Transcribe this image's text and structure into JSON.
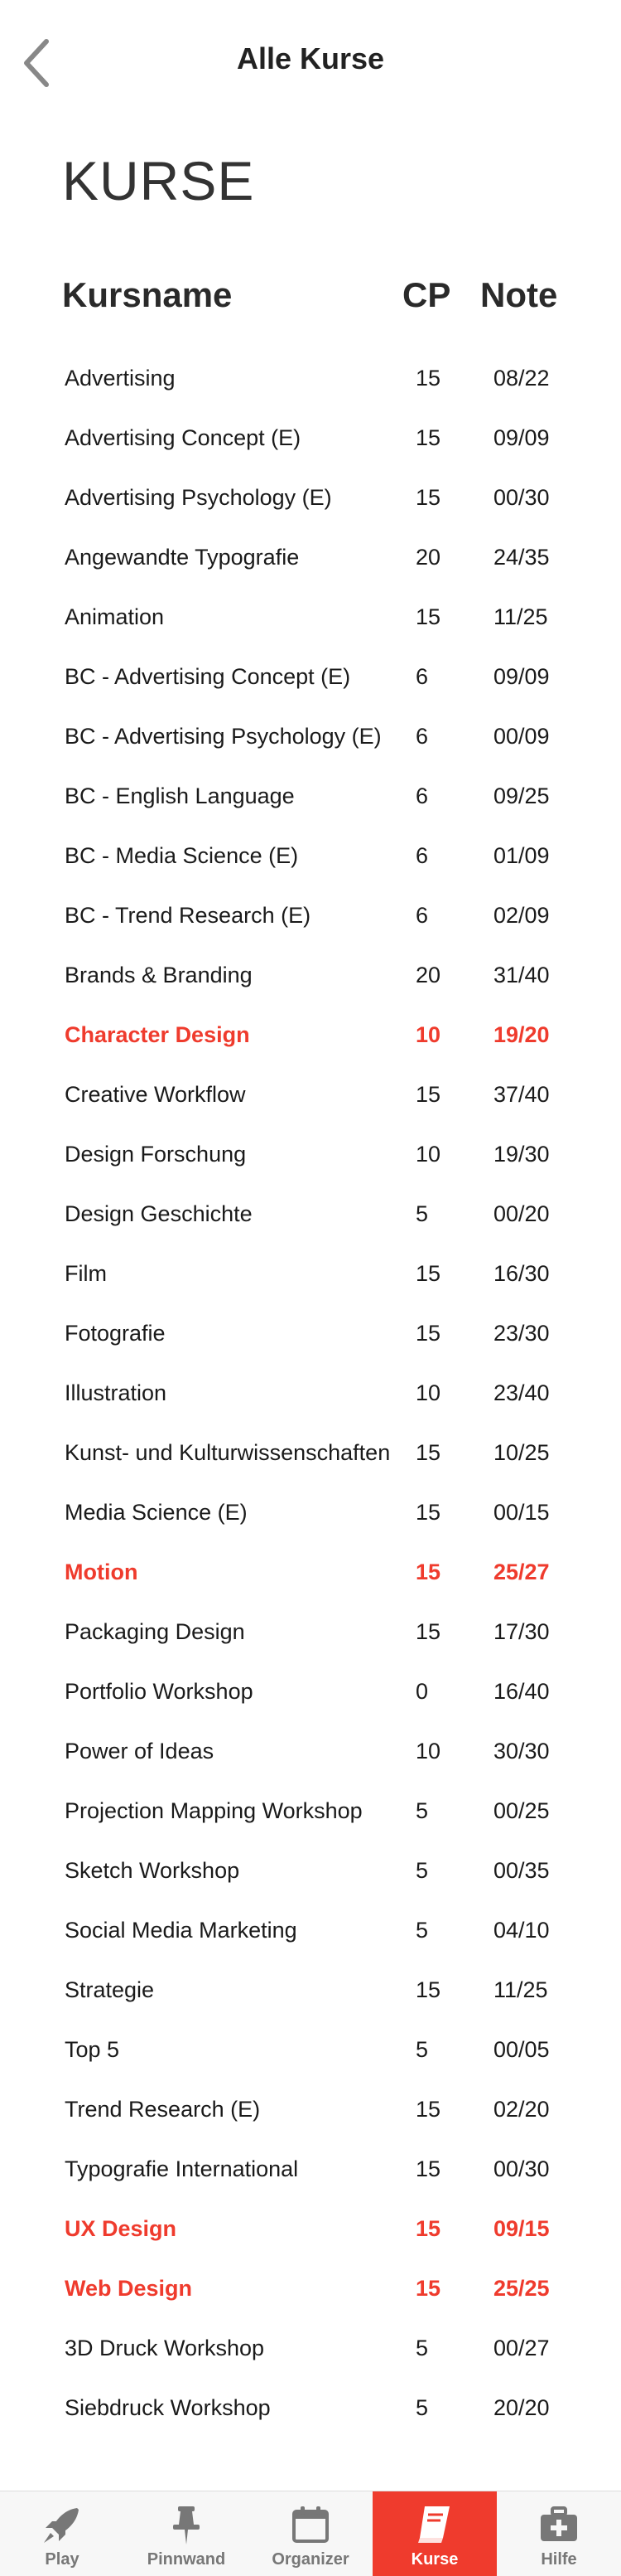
{
  "header": {
    "title": "Alle Kurse",
    "back_icon": "chevron-left-icon"
  },
  "page_title": "KURSE",
  "columns": {
    "name": "Kursname",
    "cp": "CP",
    "note": "Note"
  },
  "accent_color": "#ef3b2d",
  "courses": [
    {
      "name": "Advertising",
      "cp": "15",
      "note": "08/22",
      "highlight": false
    },
    {
      "name": "Advertising Concept (E)",
      "cp": "15",
      "note": "09/09",
      "highlight": false
    },
    {
      "name": "Advertising Psychology (E)",
      "cp": "15",
      "note": "00/30",
      "highlight": false
    },
    {
      "name": "Angewandte Typografie",
      "cp": "20",
      "note": "24/35",
      "highlight": false
    },
    {
      "name": "Animation",
      "cp": "15",
      "note": "11/25",
      "highlight": false
    },
    {
      "name": "BC - Advertising Concept (E)",
      "cp": "6",
      "note": "09/09",
      "highlight": false
    },
    {
      "name": "BC - Advertising Psychology (E)",
      "cp": "6",
      "note": "00/09",
      "highlight": false
    },
    {
      "name": "BC - English Language",
      "cp": "6",
      "note": "09/25",
      "highlight": false
    },
    {
      "name": "BC - Media Science (E)",
      "cp": "6",
      "note": "01/09",
      "highlight": false
    },
    {
      "name": "BC - Trend Research (E)",
      "cp": "6",
      "note": "02/09",
      "highlight": false
    },
    {
      "name": "Brands & Branding",
      "cp": "20",
      "note": "31/40",
      "highlight": false
    },
    {
      "name": "Character Design",
      "cp": "10",
      "note": "19/20",
      "highlight": true
    },
    {
      "name": "Creative Workflow",
      "cp": "15",
      "note": "37/40",
      "highlight": false
    },
    {
      "name": "Design Forschung",
      "cp": "10",
      "note": "19/30",
      "highlight": false
    },
    {
      "name": "Design Geschichte",
      "cp": "5",
      "note": "00/20",
      "highlight": false
    },
    {
      "name": "Film",
      "cp": "15",
      "note": "16/30",
      "highlight": false
    },
    {
      "name": "Fotografie",
      "cp": "15",
      "note": "23/30",
      "highlight": false
    },
    {
      "name": "Illustration",
      "cp": "10",
      "note": "23/40",
      "highlight": false
    },
    {
      "name": "Kunst- und Kulturwissenschaften",
      "cp": "15",
      "note": "10/25",
      "highlight": false
    },
    {
      "name": "Media Science (E)",
      "cp": "15",
      "note": "00/15",
      "highlight": false
    },
    {
      "name": "Motion",
      "cp": "15",
      "note": "25/27",
      "highlight": true
    },
    {
      "name": "Packaging Design",
      "cp": "15",
      "note": "17/30",
      "highlight": false
    },
    {
      "name": "Portfolio Workshop",
      "cp": "0",
      "note": "16/40",
      "highlight": false
    },
    {
      "name": "Power of Ideas",
      "cp": "10",
      "note": "30/30",
      "highlight": false
    },
    {
      "name": "Projection Mapping Workshop",
      "cp": "5",
      "note": "00/25",
      "highlight": false
    },
    {
      "name": "Sketch Workshop",
      "cp": "5",
      "note": "00/35",
      "highlight": false
    },
    {
      "name": "Social Media Marketing",
      "cp": "5",
      "note": "04/10",
      "highlight": false
    },
    {
      "name": "Strategie",
      "cp": "15",
      "note": "11/25",
      "highlight": false
    },
    {
      "name": "Top 5",
      "cp": "5",
      "note": "00/05",
      "highlight": false
    },
    {
      "name": "Trend Research (E)",
      "cp": "15",
      "note": "02/20",
      "highlight": false
    },
    {
      "name": "Typografie International",
      "cp": "15",
      "note": "00/30",
      "highlight": false
    },
    {
      "name": "UX Design",
      "cp": "15",
      "note": "09/15",
      "highlight": true
    },
    {
      "name": "Web Design",
      "cp": "15",
      "note": "25/25",
      "highlight": true
    },
    {
      "name": "3D Druck Workshop",
      "cp": "5",
      "note": "00/27",
      "highlight": false
    },
    {
      "name": "Siebdruck Workshop",
      "cp": "5",
      "note": "20/20",
      "highlight": false
    }
  ],
  "tabbar": [
    {
      "label": "Play",
      "icon": "rocket-icon",
      "active": false
    },
    {
      "label": "Pinnwand",
      "icon": "pushpin-icon",
      "active": false
    },
    {
      "label": "Organizer",
      "icon": "calendar-icon",
      "active": false
    },
    {
      "label": "Kurse",
      "icon": "book-icon",
      "active": true
    },
    {
      "label": "Hilfe",
      "icon": "medical-kit-icon",
      "active": false
    }
  ]
}
